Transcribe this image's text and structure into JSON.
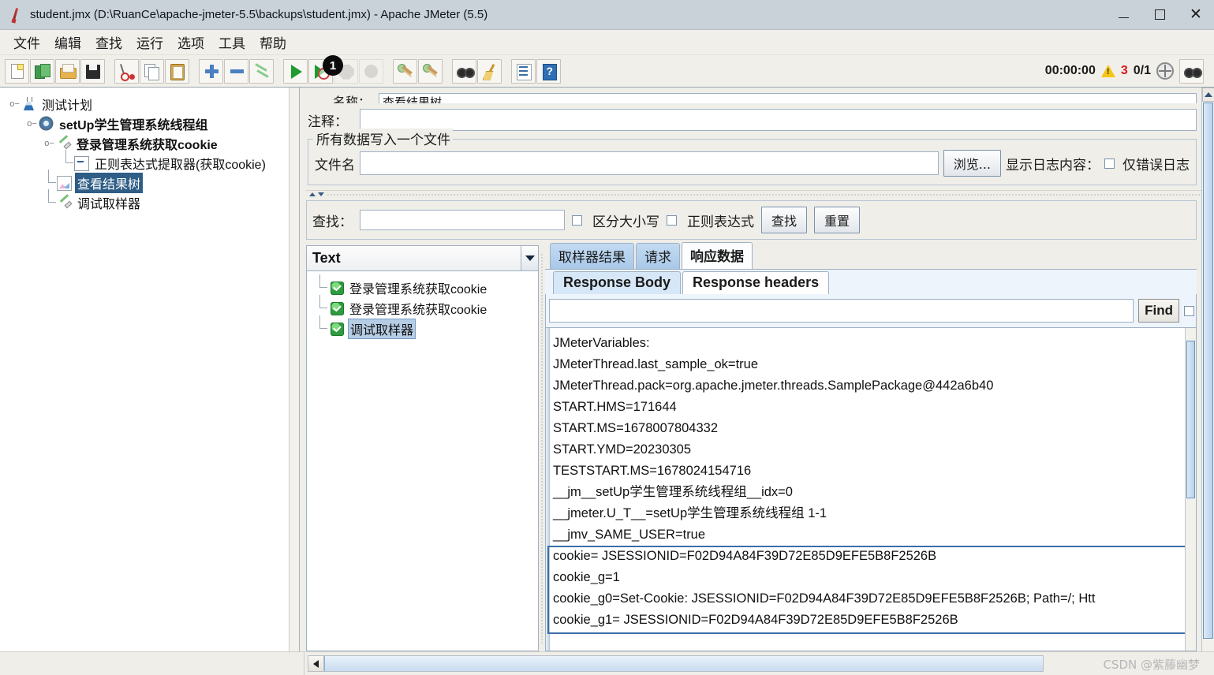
{
  "window": {
    "title": "student.jmx (D:\\RuanCe\\apache-jmeter-5.5\\backups\\student.jmx) - Apache JMeter (5.5)",
    "app_icon": "jmeter-feather-icon",
    "minimize": "−",
    "maximize": "□",
    "close": "✕"
  },
  "menu": {
    "items": [
      {
        "label": "文件",
        "name": "menu-file"
      },
      {
        "label": "编辑",
        "name": "menu-edit"
      },
      {
        "label": "查找",
        "name": "menu-search"
      },
      {
        "label": "运行",
        "name": "menu-run"
      },
      {
        "label": "选项",
        "name": "menu-options"
      },
      {
        "label": "工具",
        "name": "menu-tools"
      },
      {
        "label": "帮助",
        "name": "menu-help"
      }
    ]
  },
  "toolbar": {
    "badge": "1",
    "status": {
      "elapsed": "00:00:00",
      "warning_count": "3",
      "threads": "0/1"
    },
    "icons": [
      "new-icon",
      "templates-icon",
      "open-icon",
      "save-icon",
      "cut-icon",
      "copy-icon",
      "paste-icon",
      "expand-icon",
      "collapse-icon",
      "toggle-icon",
      "start-icon",
      "start-no-pauses-icon",
      "stop-icon",
      "shutdown-icon",
      "clear-icon",
      "clear-all-icon",
      "search-icon",
      "reset-search-icon",
      "function-helper-icon",
      "help-icon"
    ]
  },
  "tree": {
    "nodes": [
      {
        "label": "测试计划",
        "icon": "flask-icon",
        "depth": 0,
        "selected": false,
        "bold": false
      },
      {
        "label": "setUp学生管理系统线程组",
        "icon": "gear-icon",
        "depth": 1,
        "selected": false,
        "bold": true
      },
      {
        "label": "登录管理系统获取cookie",
        "icon": "pipette-icon",
        "depth": 2,
        "selected": false,
        "bold": true
      },
      {
        "label": "正则表达式提取器(获取cookie)",
        "icon": "arrow-box-icon",
        "depth": 3,
        "selected": false,
        "bold": false
      },
      {
        "label": "查看结果树",
        "icon": "chart-icon",
        "depth": 2,
        "selected": true,
        "bold": false
      },
      {
        "label": "调试取样器",
        "icon": "pipette-icon",
        "depth": 2,
        "selected": false,
        "bold": false
      }
    ]
  },
  "config": {
    "name_label_cut": "名称：",
    "name_value_cut": "查看结果树",
    "comment_label": "注释：",
    "comment_value": "",
    "group_legend": "所有数据写入一个文件",
    "filename_label": "文件名",
    "filename_value": "",
    "browse_button": "浏览...",
    "log_display_label": "显示日志内容：",
    "errors_only_label": "仅错误日志",
    "errors_only_checked": false
  },
  "search": {
    "label": "查找：",
    "value": "",
    "case_sensitive_label": "区分大小写",
    "case_sensitive_checked": false,
    "regex_label": "正则表达式",
    "regex_checked": false,
    "find_button": "查找",
    "reset_button": "重置"
  },
  "results": {
    "renderer_selected": "Text",
    "items": [
      {
        "label": "登录管理系统获取cookie",
        "status": "ok",
        "selected": false
      },
      {
        "label": "登录管理系统获取cookie",
        "status": "ok",
        "selected": false
      },
      {
        "label": "调试取样器",
        "status": "ok",
        "selected": true
      }
    ]
  },
  "detail_tabs": {
    "primary": [
      {
        "label": "取样器结果",
        "active": false
      },
      {
        "label": "请求",
        "active": false
      },
      {
        "label": "响应数据",
        "active": true
      }
    ],
    "secondary": [
      {
        "label": "Response Body",
        "active": true
      },
      {
        "label": "Response headers",
        "active": false
      }
    ]
  },
  "find_bar": {
    "value": "",
    "button": "Find",
    "checkbox_checked": false
  },
  "response_body": {
    "lines": [
      "JMeterVariables:",
      "JMeterThread.last_sample_ok=true",
      "JMeterThread.pack=org.apache.jmeter.threads.SamplePackage@442a6b40",
      "START.HMS=171644",
      "START.MS=1678007804332",
      "START.YMD=20230305",
      "TESTSTART.MS=1678024154716",
      "__jm__setUp学生管理系统线程组__idx=0",
      "__jmeter.U_T__=setUp学生管理系统线程组 1-1",
      "__jmv_SAME_USER=true",
      "cookie= JSESSIONID=F02D94A84F39D72E85D9EFE5B8F2526B",
      "cookie_g=1",
      "cookie_g0=Set-Cookie: JSESSIONID=F02D94A84F39D72E85D9EFE5B8F2526B; Path=/; Htt",
      "cookie_g1= JSESSIONID=F02D94A84F39D72E85D9EFE5B8F2526B"
    ],
    "highlight_start_index": 10,
    "highlight_end_index": 13
  },
  "statusbar": {
    "watermark": "CSDN @紫藤幽梦"
  },
  "colors": {
    "titlebar": "#c9d2d9",
    "selection": "#2e5d86",
    "tab_active": "#d6e7f8",
    "error": "#d21919",
    "warning": "#f5c518",
    "highlight_border": "#3b6ea8"
  }
}
